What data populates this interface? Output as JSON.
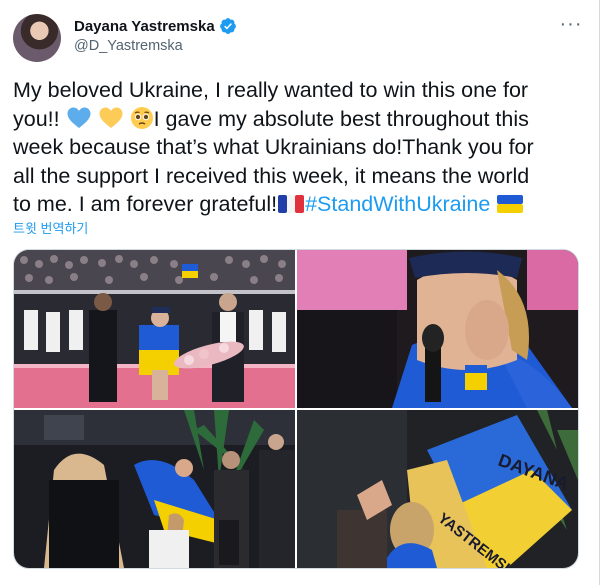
{
  "author": {
    "name": "Dayana Yastremska",
    "handle": "@D_Yastremska",
    "verified": true
  },
  "tweet": {
    "line1": "My beloved Ukraine, I really wanted to win this one for",
    "line2_start": "you!! ",
    "line2_end": "I gave my absolute best throughout this",
    "line3": "week because that’s what Ukrainians do!Thank you for",
    "line4": "all the support I received this week, it means the world",
    "line5_start": "to me. I am forever grateful!",
    "hashtag": "#StandWithUkraine",
    "emojis": [
      "blue-heart",
      "yellow-heart",
      "pleading-face",
      "france-flag",
      "ukraine-flag"
    ]
  },
  "translate_label": "트윗 번역하기",
  "menu_icon": "more-dots",
  "media": {
    "photo4_text_1": "DAYANA",
    "photo4_text_2": "YASTREMSKA"
  },
  "colors": {
    "link": "#1d9bf0",
    "verified": "#1d9bf0",
    "secondary_text": "#536471",
    "ukraine_blue": "#1e5bd4",
    "ukraine_yellow": "#f5d000"
  }
}
